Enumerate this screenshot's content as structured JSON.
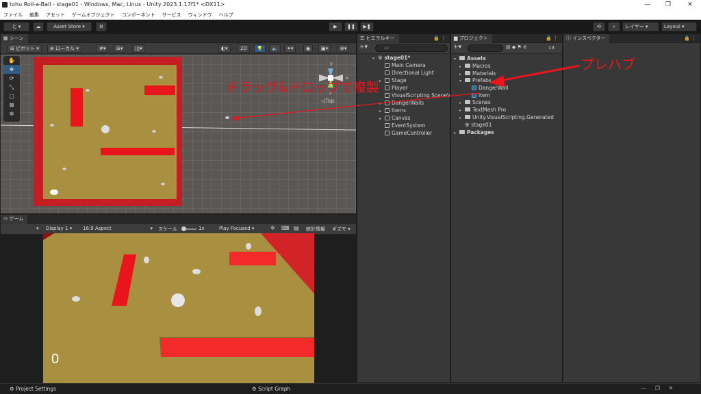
{
  "window": {
    "title": "tohu Roll-a-Ball - stage01 - Windows, Mac, Linux - Unity 2023.1.17f1* <DX11>",
    "minimize": "—",
    "maximize": "❐",
    "close": "✕"
  },
  "menu": [
    "ファイル",
    "編集",
    "アセット",
    "ゲームオブジェクト",
    "コンポーネント",
    "サービス",
    "ウィンドウ",
    "ヘルプ"
  ],
  "toolbar": {
    "account": "と ▾",
    "asset_store": "Asset Store ▾",
    "layer": "レイヤー",
    "layout": "Layout"
  },
  "scene": {
    "tab": "シーン",
    "pivot": "ピボット",
    "local": "ローカル",
    "mode_2d": "2D",
    "gizmo_label": "Top",
    "gizmo_axes": {
      "y": "y",
      "z": "z",
      "x": "x"
    }
  },
  "game": {
    "tab": "ゲーム",
    "display": "Display 1",
    "aspect": "16:9 Aspect",
    "scale_label": "スケール",
    "scale_value": "1x",
    "play_focused": "Play Focused",
    "stats": "統計情報",
    "gizmos": "ギズモ",
    "score": "0"
  },
  "hierarchy": {
    "tab": "ヒエラルキー",
    "search_placeholder": "All",
    "scene": "stage01*",
    "items": [
      "Main Camera",
      "Directional Light",
      "Stage",
      "Player",
      "VisualScripting SceneVariables",
      "DangerWalls",
      "Items",
      "Canvas",
      "EventSystem",
      "GameController"
    ]
  },
  "project": {
    "tab": "プロジェクト",
    "badge": "13",
    "assets": "Assets",
    "folders": [
      "Macros",
      "Materials",
      "Prefabs"
    ],
    "prefab_children": [
      "DangerWall",
      "Item"
    ],
    "folders2": [
      "Scenes",
      "TextMesh Pro",
      "Unity.VisualScripting.Generated"
    ],
    "scene_file": "stage01",
    "packages": "Packages"
  },
  "inspector": {
    "tab": "インスペクター"
  },
  "annotations": {
    "drag": "ドラッグ&ドロップで複製",
    "prefab": "プレハブ"
  },
  "bottom": {
    "project_settings": "Project Settings",
    "script_graph": "Script Graph"
  },
  "colors": {
    "annotation": "#e8151b",
    "floor": "#a89040",
    "wall": "#c41e22"
  }
}
